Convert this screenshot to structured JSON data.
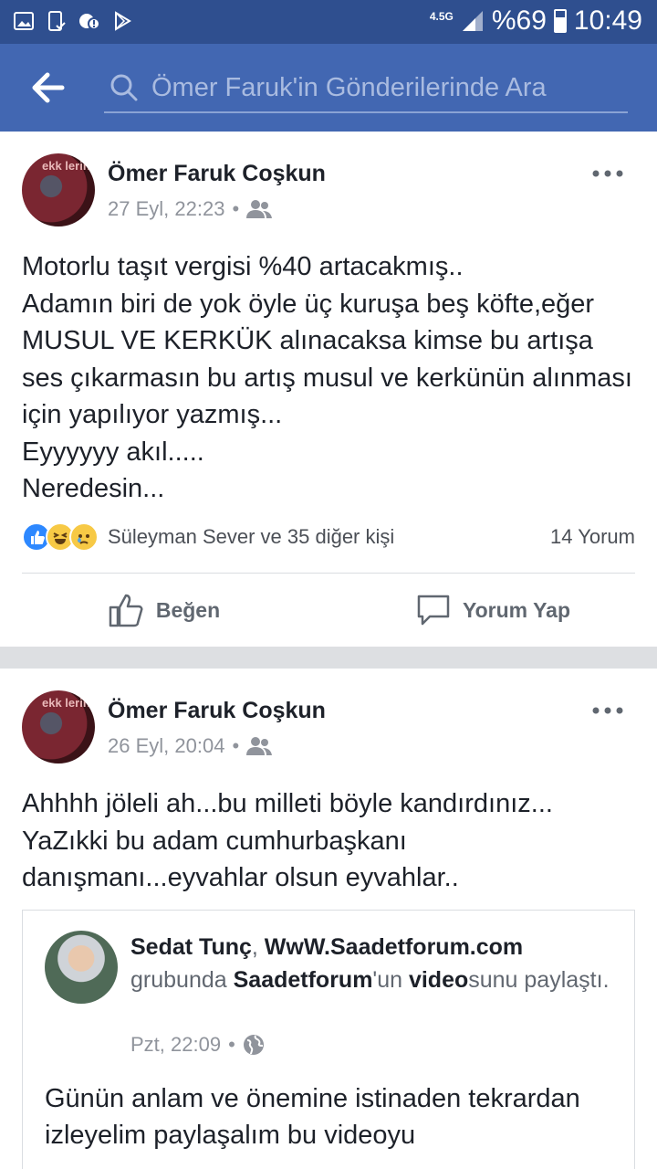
{
  "status_bar": {
    "network": "4.5G",
    "battery": "%69",
    "time": "10:49"
  },
  "search": {
    "placeholder": "Ömer Faruk'in Gönderilerinde Ara"
  },
  "posts": [
    {
      "author": "Ömer Faruk Coşkun",
      "timestamp": "27 Eyl, 22:23",
      "separator": "•",
      "audience_icon": "friends-icon",
      "text": "Motorlu taşıt vergisi %40 artacakmış..\nAdamın biri de yok öyle üç kuruşa beş köfte,eğer MUSUL VE KERKÜK alınacaksa kimse bu artışa ses çıkarmasın bu artış musul ve kerkünün alınması için yapılıyor yazmış...\nEyyyyyy akıl.....\nNeredesin...",
      "reaction_names": "Süleyman Sever ve 35 diğer kişi",
      "comment_count": "14 Yorum",
      "like_label": "Beğen",
      "comment_label": "Yorum Yap"
    },
    {
      "author": "Ömer Faruk Coşkun",
      "timestamp": "26 Eyl, 20:04",
      "separator": "•",
      "audience_icon": "friends-icon",
      "text": "Ahhhh jöleli ah...bu milleti böyle kandırdınız...\nYaZıkki bu adam cumhurbaşkanı danışmanı...eyvahlar olsun eyvahlar..",
      "shared": {
        "user": "Sedat Tunç",
        "comma": ", ",
        "group": "WwW.Saadetforum.com",
        "mid1": " grubunda ",
        "page": "Saadetforum",
        "mid2": "'un ",
        "content_type": "video",
        "mid3": "sunu paylaştı.",
        "timestamp": "Pzt, 22:09",
        "separator": "•",
        "audience_icon": "globe-icon",
        "text": "Günün anlam ve önemine istinaden tekrardan izleyelim paylaşalım bu videoyu"
      }
    }
  ],
  "colors": {
    "status_bar": "#2f4f8f",
    "header": "#4267b2",
    "separator": "#dddfe2",
    "like_blue": "#2d88ff",
    "haha_yellow": "#f7c945"
  }
}
